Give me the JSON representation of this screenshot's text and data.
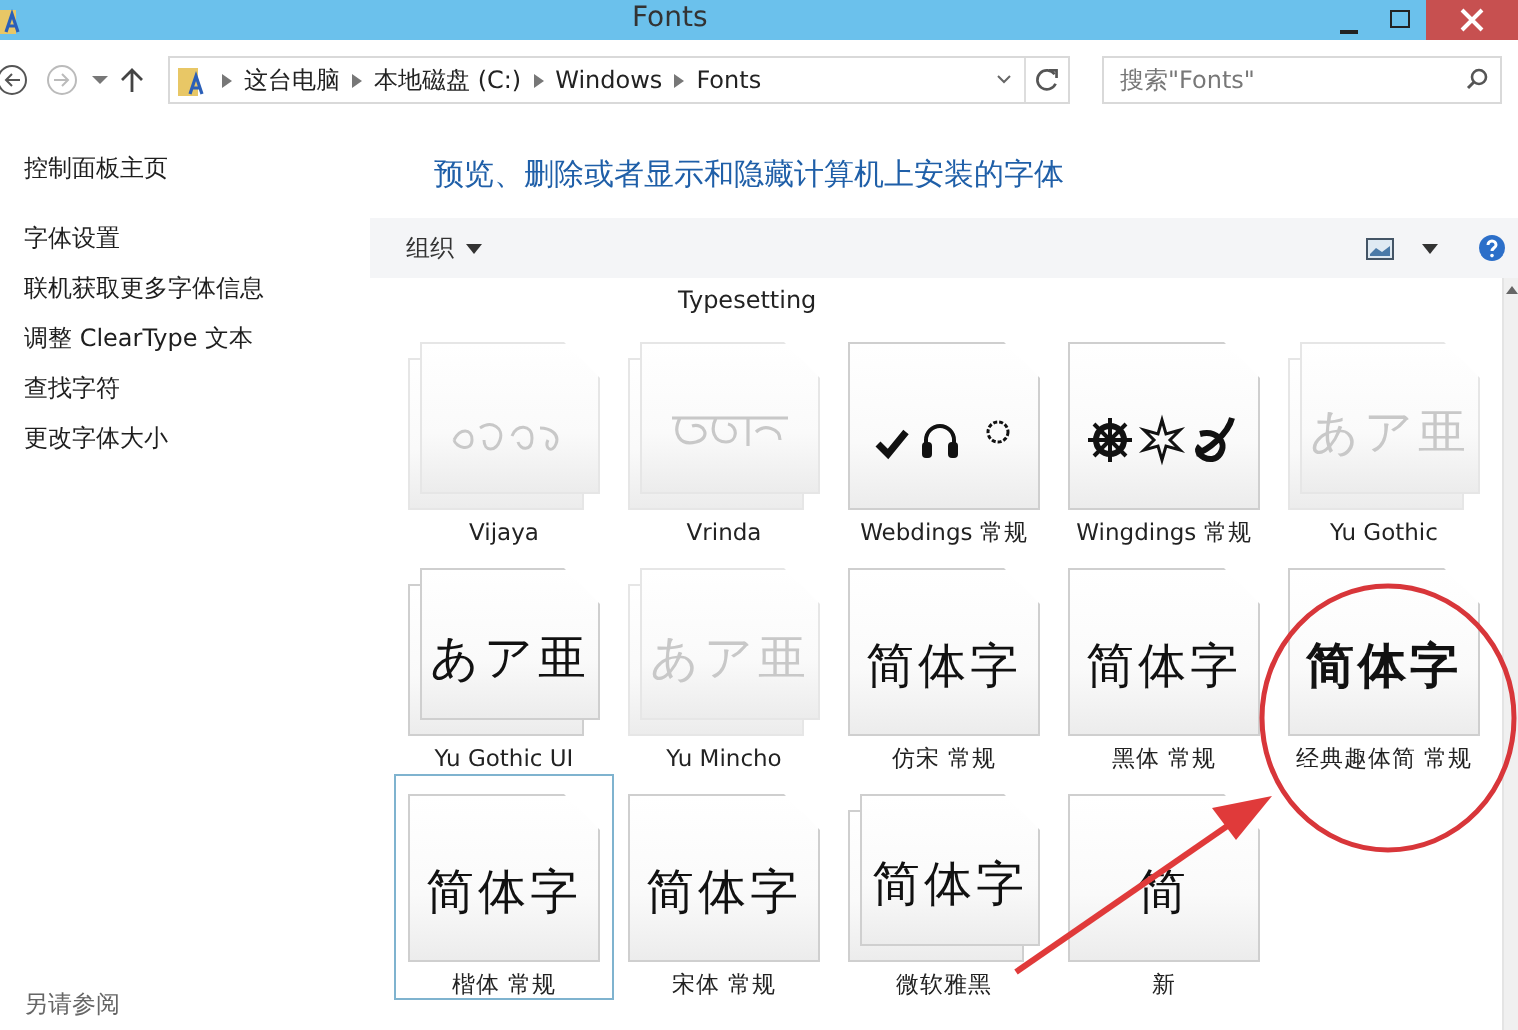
{
  "window": {
    "title": "Fonts"
  },
  "address_bar": {
    "segments": [
      "这台电脑",
      "本地磁盘 (C:)",
      "Windows",
      "Fonts"
    ]
  },
  "search": {
    "placeholder": "搜索\"Fonts\""
  },
  "sidebar": {
    "items": [
      {
        "label": "控制面板主页"
      },
      {
        "label": "字体设置"
      },
      {
        "label": "联机获取更多字体信息"
      },
      {
        "label": "调整 ClearType 文本"
      },
      {
        "label": "查找字符"
      },
      {
        "label": "更改字体大小"
      }
    ],
    "see_also": "另请参阅"
  },
  "heading": "预览、删除或者显示和隐藏计算机上安装的字体",
  "toolbar": {
    "organize": "组织"
  },
  "partial_label": "Typesetting",
  "fonts": [
    {
      "name": "Vijaya",
      "kind": "tamil",
      "dimmed": true,
      "stacked": true,
      "selected": false
    },
    {
      "name": "Vrinda",
      "kind": "bengali",
      "dimmed": true,
      "stacked": true,
      "selected": false
    },
    {
      "name": "Webdings 常规",
      "kind": "webdings",
      "dimmed": false,
      "stacked": false,
      "selected": false
    },
    {
      "name": "Wingdings 常规",
      "kind": "wingdings",
      "dimmed": false,
      "stacked": false,
      "selected": false
    },
    {
      "name": "Yu Gothic",
      "kind": "text",
      "sample": "あア亜",
      "dimmed": true,
      "stacked": true,
      "selected": false
    },
    {
      "name": "Yu Gothic UI",
      "kind": "text",
      "sample": "あア亜",
      "dimmed": false,
      "stacked": true,
      "selected": false
    },
    {
      "name": "Yu Mincho",
      "kind": "text",
      "sample": "あア亜",
      "dimmed": true,
      "stacked": true,
      "selected": false
    },
    {
      "name": "仿宋 常规",
      "kind": "text",
      "sample": "简体字",
      "dimmed": false,
      "stacked": false,
      "selected": false
    },
    {
      "name": "黑体 常规",
      "kind": "text",
      "sample": "简体字",
      "dimmed": false,
      "stacked": false,
      "selected": false
    },
    {
      "name": "经典趣体简 常规",
      "kind": "text",
      "sample": "简体字",
      "dimmed": false,
      "stacked": false,
      "selected": false,
      "bold": true
    },
    {
      "name": "楷体 常规",
      "kind": "text",
      "sample": "简体字",
      "dimmed": false,
      "stacked": false,
      "selected": true
    },
    {
      "name": "宋体 常规",
      "kind": "text",
      "sample": "简体字",
      "dimmed": false,
      "stacked": false,
      "selected": false
    },
    {
      "name": "微软雅黑",
      "kind": "text",
      "sample": "简体字",
      "dimmed": false,
      "stacked": true,
      "selected": false
    },
    {
      "name": "新",
      "kind": "text",
      "sample": "简",
      "dimmed": false,
      "stacked": false,
      "selected": false
    }
  ]
}
